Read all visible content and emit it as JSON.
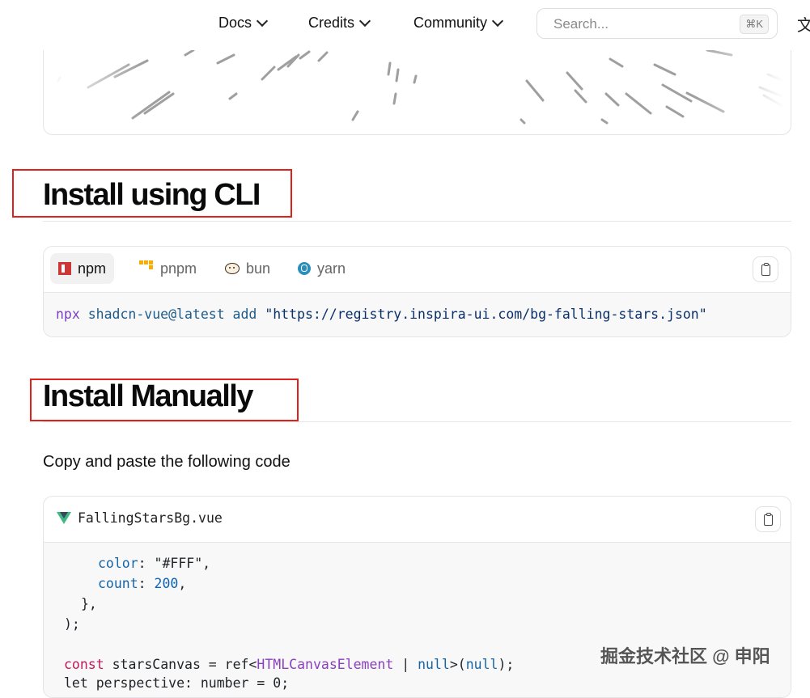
{
  "nav": {
    "items": [
      "Docs",
      "Credits",
      "Community"
    ],
    "search_placeholder": "Search...",
    "search_shortcut": "⌘K",
    "lang_icon": "文"
  },
  "sections": {
    "cli_heading": "Install using CLI",
    "manual_heading": "Install Manually",
    "manual_text": "Copy and paste the following code"
  },
  "cli": {
    "tabs": [
      "npm",
      "pnpm",
      "bun",
      "yarn"
    ],
    "active_tab": "npm",
    "command_kw": "npx",
    "command_rest": "shadcn-vue@latest add",
    "command_url": "\"https://registry.inspira-ui.com/bg-falling-stars.json\""
  },
  "file": {
    "name": "FallingStarsBg.vue",
    "lines": {
      "l1_prop": "color",
      "l1_rest": ": \"#FFF\",",
      "l2_prop": "count",
      "l2_colon": ": ",
      "l2_num": "200",
      "l2_end": ",",
      "l3": "},",
      "l4": ");",
      "l6_kw": "const",
      "l6_a": " starsCanvas = ref<",
      "l6_type": "HTMLCanvasElement",
      "l6_b": " | ",
      "l6_null1": "null",
      "l6_c": ">(",
      "l6_null2": "null",
      "l6_d": ");",
      "l7": "let perspective: number = 0;"
    }
  },
  "watermark": "掘金技术社区 @ 申阳",
  "colors": {
    "highlight_box": "#e0211b",
    "border": "#e4e4e7",
    "code_bg": "#f8f8f8"
  }
}
